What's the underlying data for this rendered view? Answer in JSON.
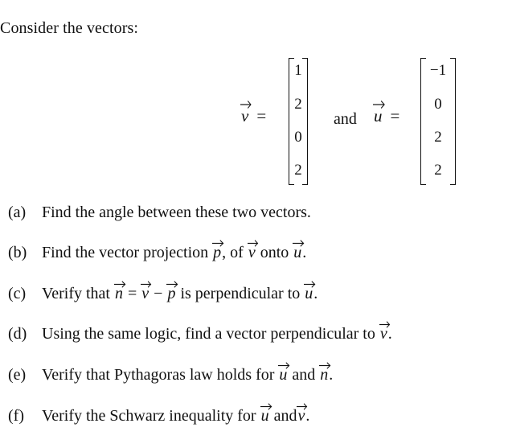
{
  "intro": "Consider the vectors:",
  "vectors": {
    "v": {
      "symbol": "v",
      "equals": "=",
      "entries": [
        "1",
        "2",
        "0",
        "2"
      ]
    },
    "conjunction": "and",
    "u": {
      "symbol": "u",
      "equals": "=",
      "entries": [
        "−1",
        "0",
        "2",
        "2"
      ]
    }
  },
  "questions": [
    {
      "letter": "(a)",
      "parts": [
        {
          "t": "text",
          "v": "Find the angle between these two vectors."
        }
      ]
    },
    {
      "letter": "(b)",
      "parts": [
        {
          "t": "text",
          "v": "Find the vector projection "
        },
        {
          "t": "vec",
          "v": "p"
        },
        {
          "t": "text",
          "v": ", of "
        },
        {
          "t": "vec",
          "v": "v"
        },
        {
          "t": "text",
          "v": " onto "
        },
        {
          "t": "vec",
          "v": "u"
        },
        {
          "t": "text",
          "v": "."
        }
      ]
    },
    {
      "letter": "(c)",
      "parts": [
        {
          "t": "text",
          "v": "Verify that "
        },
        {
          "t": "vec",
          "v": "n"
        },
        {
          "t": "text",
          "v": " = "
        },
        {
          "t": "vec",
          "v": "v"
        },
        {
          "t": "text",
          "v": " − "
        },
        {
          "t": "vec",
          "v": "p"
        },
        {
          "t": "text",
          "v": " is perpendicular to "
        },
        {
          "t": "vec",
          "v": "u"
        },
        {
          "t": "text",
          "v": "."
        }
      ]
    },
    {
      "letter": "(d)",
      "parts": [
        {
          "t": "text",
          "v": "Using the same logic, find a vector perpendicular to "
        },
        {
          "t": "vec",
          "v": "v"
        },
        {
          "t": "text",
          "v": "."
        }
      ]
    },
    {
      "letter": "(e)",
      "parts": [
        {
          "t": "text",
          "v": "Verify that Pythagoras law holds for "
        },
        {
          "t": "vec",
          "v": "u"
        },
        {
          "t": "text",
          "v": " and "
        },
        {
          "t": "vec",
          "v": "n"
        },
        {
          "t": "text",
          "v": "."
        }
      ]
    },
    {
      "letter": "(f)",
      "parts": [
        {
          "t": "text",
          "v": "Verify the Schwarz inequality for "
        },
        {
          "t": "vec",
          "v": "u"
        },
        {
          "t": "text",
          "v": " and"
        },
        {
          "t": "vec",
          "v": "v"
        },
        {
          "t": "text",
          "v": "."
        }
      ]
    }
  ]
}
